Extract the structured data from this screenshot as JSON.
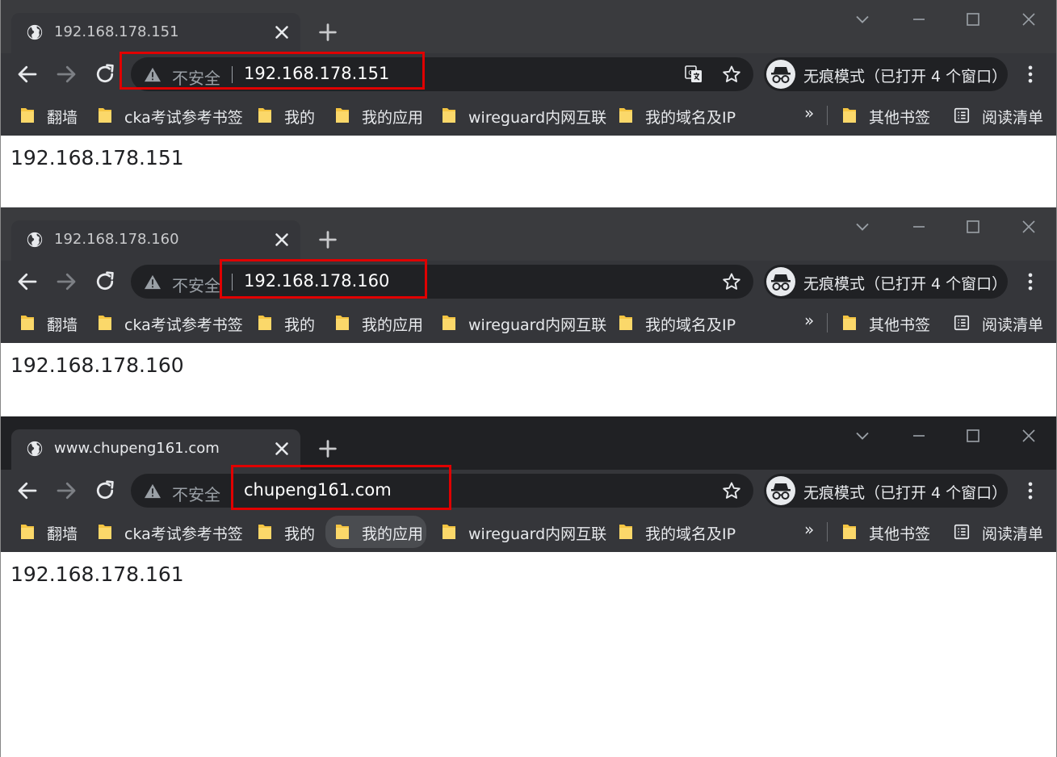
{
  "windows": [
    {
      "tab_title": "192.168.178.151",
      "insecure_label": "不安全",
      "url": "192.168.178.151",
      "incognito_label": "无痕模式（已打开 4 个窗口）",
      "page_text": "192.168.178.151",
      "show_translate": true
    },
    {
      "tab_title": "192.168.178.160",
      "insecure_label": "不安全",
      "url": "192.168.178.160",
      "incognito_label": "无痕模式（已打开 4 个窗口）",
      "page_text": "192.168.178.160",
      "show_translate": false
    },
    {
      "tab_title": "www.chupeng161.com",
      "insecure_label": "不安全",
      "url": "chupeng161.com",
      "incognito_label": "无痕模式（已打开 4 个窗口）",
      "page_text": "192.168.178.161",
      "show_translate": false
    }
  ],
  "bookmarks": [
    {
      "label": "翻墙"
    },
    {
      "label": "cka考试参考书签"
    },
    {
      "label": "我的"
    },
    {
      "label": "我的应用"
    },
    {
      "label": "wireguard内网互联"
    },
    {
      "label": "我的域名及IP"
    }
  ],
  "overflow_label": "»",
  "other_bookmarks_label": "其他书签",
  "reading_list_label": "阅读清单",
  "colors": {
    "highlight": "#e00000",
    "folder": "#f5c542",
    "toolbar": "#35363a",
    "tabstrip_inactive": "#3a3b3e",
    "tabstrip_active": "#202124"
  }
}
